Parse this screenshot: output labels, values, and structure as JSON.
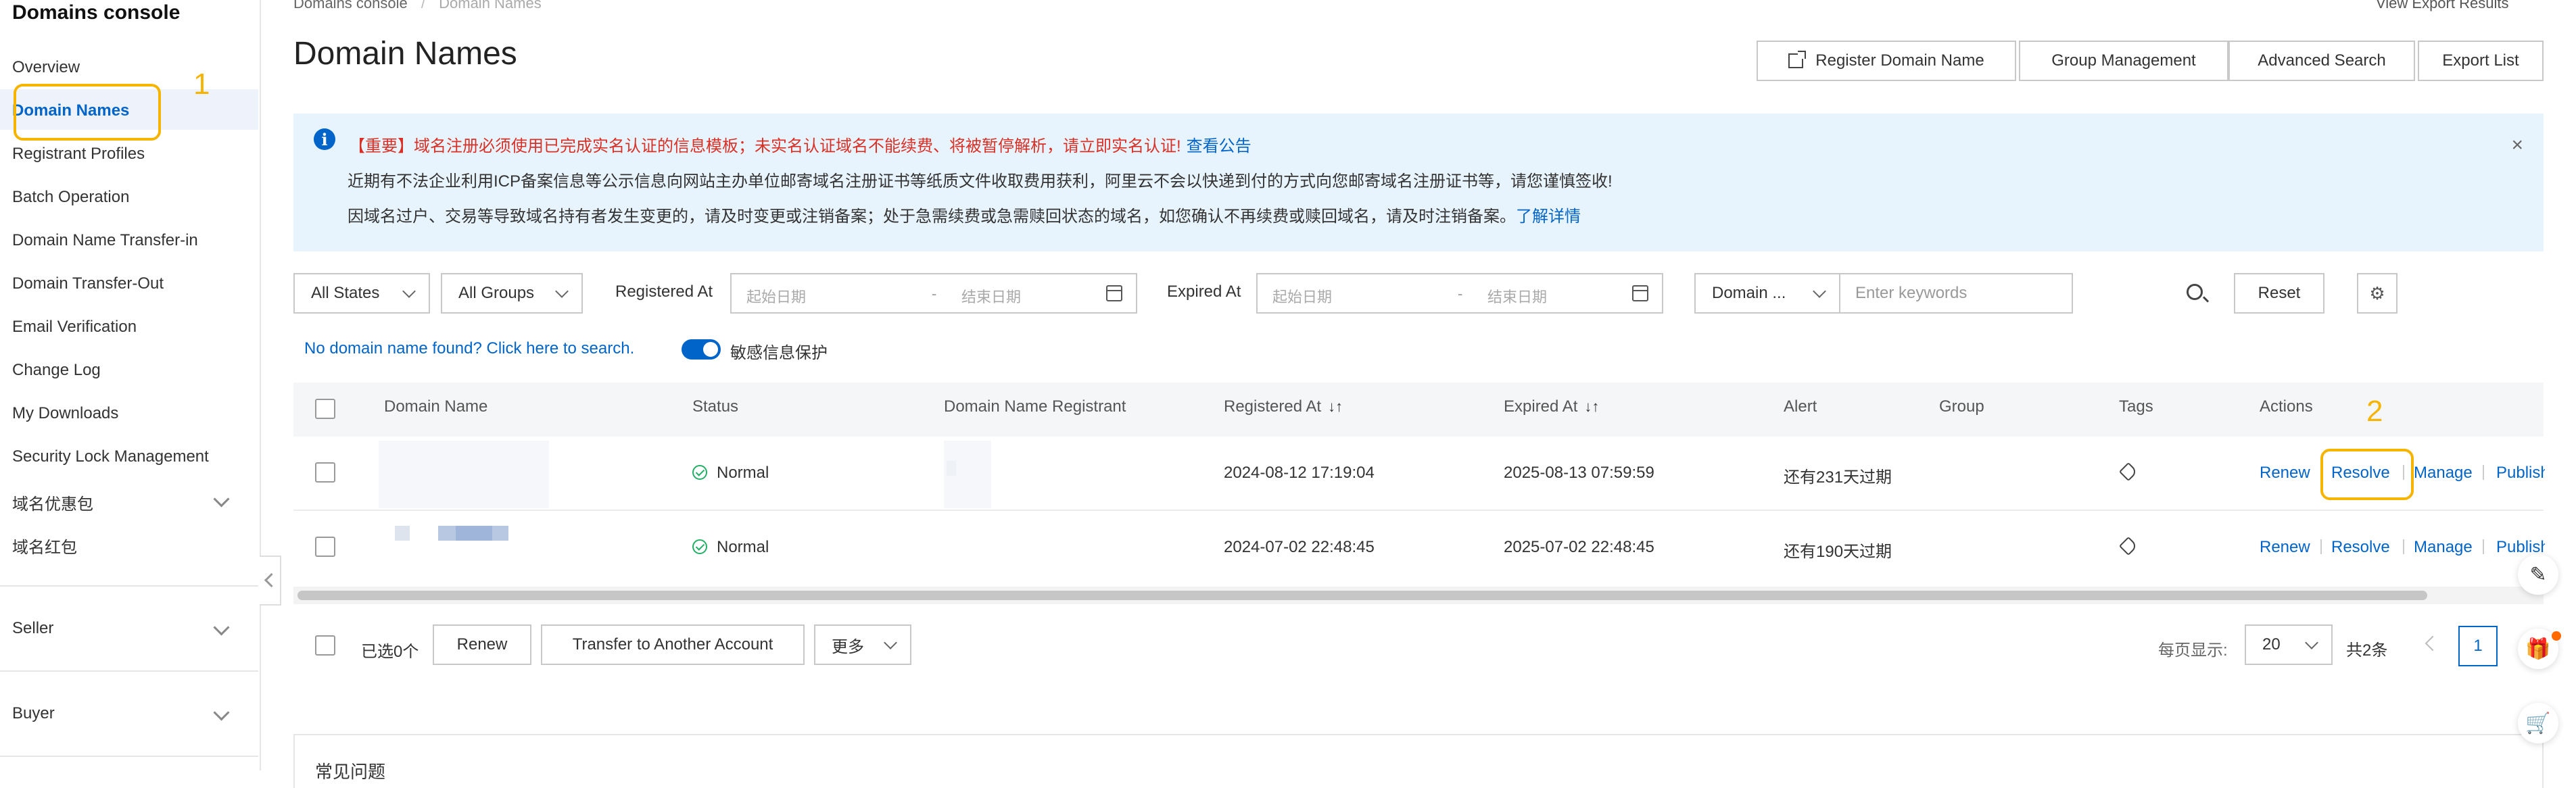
{
  "sidebar": {
    "title": "Domains console",
    "items": [
      {
        "label": "Overview"
      },
      {
        "label": "Domain Names"
      },
      {
        "label": "Registrant Profiles"
      },
      {
        "label": "Batch Operation"
      },
      {
        "label": "Domain Name Transfer-in"
      },
      {
        "label": "Domain Transfer-Out"
      },
      {
        "label": "Email Verification"
      },
      {
        "label": "Change Log"
      },
      {
        "label": "My Downloads"
      },
      {
        "label": "Security Lock Management"
      },
      {
        "label": "域名优惠包"
      },
      {
        "label": "域名红包"
      }
    ],
    "groups": [
      {
        "label": "Seller"
      },
      {
        "label": "Buyer"
      }
    ]
  },
  "breadcrumb": {
    "root": "Domains console",
    "sep": "/",
    "current": "Domain Names"
  },
  "header": {
    "title": "Domain Names",
    "view_export": "View Export Results",
    "buttons": {
      "register": "Register Domain Name",
      "group": "Group Management",
      "advanced": "Advanced Search",
      "export": "Export List"
    }
  },
  "banner": {
    "line1": "【重要】域名注册必须使用已完成实名认证的信息模板；未实名认证域名不能续费、将被暂停解析，请立即实名认证!",
    "line1_link": "查看公告",
    "line2": "近期有不法企业利用ICP备案信息等公示信息向网站主办单位邮寄域名注册证书等纸质文件收取费用获利，阿里云不会以快递到付的方式向您邮寄域名注册证书等，请您谨慎签收!",
    "line3": "因域名过户、交易等导致域名持有者发生变更的，请及时变更或注销备案；处于急需续费或急需赎回状态的域名，如您确认不再续费或赎回域名，请及时注销备案。",
    "line3_link": "了解详情",
    "close": "×"
  },
  "filters": {
    "states": "All States",
    "groups": "All Groups",
    "registered_label": "Registered At",
    "expired_label": "Expired At",
    "start_placeholder": "起始日期",
    "end_placeholder": "结束日期",
    "range_sep": "-",
    "domain_field": "Domain ...",
    "keyword_placeholder": "Enter keywords",
    "reset": "Reset",
    "gear": "⚙"
  },
  "helper": {
    "not_found": "No domain name found? Click here to search.",
    "privacy_toggle": "敏感信息保护"
  },
  "table": {
    "columns": [
      "Domain Name",
      "Status",
      "Domain Name Registrant",
      "Registered At",
      "Expired At",
      "Alert",
      "Group",
      "Tags",
      "Actions"
    ],
    "sort_glyph": "↓↑",
    "rows": [
      {
        "status": "Normal",
        "registered": "2024-08-12 17:19:04",
        "expired": "2025-08-13 07:59:59",
        "alert": "还有231天过期"
      },
      {
        "status": "Normal",
        "registered": "2024-07-02 22:48:45",
        "expired": "2025-07-02 22:48:45",
        "alert": "还有190天过期"
      }
    ],
    "actions": {
      "renew": "Renew",
      "resolve": "Resolve",
      "manage": "Manage",
      "publish": "Publish"
    }
  },
  "footer": {
    "selected": "已选0个",
    "renew": "Renew",
    "transfer": "Transfer to Another Account",
    "more": "更多",
    "per_page_label": "每页显示:",
    "per_page": "20",
    "total": "共2条",
    "current_page": "1"
  },
  "faq": {
    "title": "常见问题"
  },
  "annotations": {
    "one": "1",
    "two": "2"
  },
  "floating": {
    "edit": "✎",
    "gift": "🎁",
    "cart": "🛒"
  },
  "colors": {
    "accent": "#0064c8",
    "annotation": "#f5b400",
    "warning_text": "#d93026",
    "success": "#23b066",
    "banner_bg": "#e8f4fd"
  }
}
